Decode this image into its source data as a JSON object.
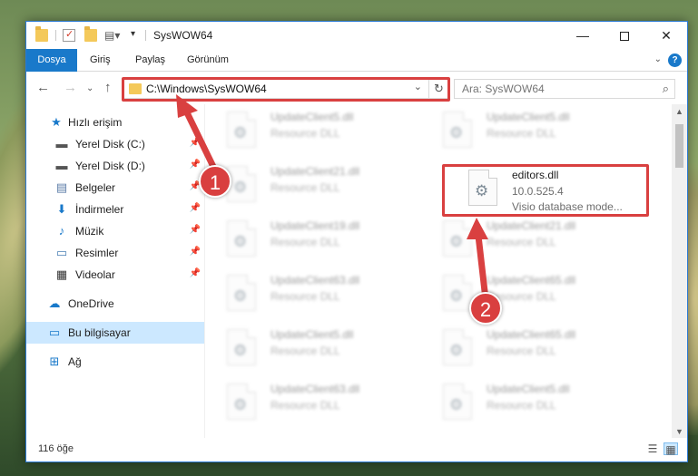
{
  "window": {
    "title": "SysWOW64",
    "controls": {
      "minimize": "—",
      "maximize": "",
      "close": "✕"
    }
  },
  "ribbon": {
    "tabs": [
      "Dosya",
      "Giriş",
      "Paylaş",
      "Görünüm"
    ],
    "help": "?"
  },
  "address": {
    "path": "C:\\Windows\\SysWOW64",
    "search_placeholder": "Ara: SysWOW64"
  },
  "nav_pane": {
    "items": [
      {
        "label": "Hızlı erişim",
        "icon": "star-icon"
      },
      {
        "label": "Yerel Disk (C:)",
        "icon": "drive-icon",
        "pinned": true
      },
      {
        "label": "Yerel Disk (D:)",
        "icon": "drive-icon",
        "pinned": true
      },
      {
        "label": "Belgeler",
        "icon": "document-icon",
        "pinned": true
      },
      {
        "label": "İndirmeler",
        "icon": "download-icon",
        "pinned": true
      },
      {
        "label": "Müzik",
        "icon": "music-icon",
        "pinned": true
      },
      {
        "label": "Resimler",
        "icon": "picture-icon",
        "pinned": true
      },
      {
        "label": "Videolar",
        "icon": "video-icon",
        "pinned": true
      },
      {
        "label": "OneDrive",
        "icon": "cloud-icon"
      },
      {
        "label": "Bu bilgisayar",
        "icon": "computer-icon",
        "selected": true
      },
      {
        "label": "Ağ",
        "icon": "network-icon"
      }
    ]
  },
  "files": {
    "left": [
      {
        "name": "UpdateClient5.dll",
        "type": "Resource DLL"
      },
      {
        "name": "UpdateClient21.dll",
        "type": "Resource DLL"
      },
      {
        "name": "UpdateClient19.dll",
        "type": "Resource DLL"
      },
      {
        "name": "UpdateClient63.dll",
        "type": "Resource DLL"
      },
      {
        "name": "UpdateClient5.dll",
        "type": "Resource DLL"
      },
      {
        "name": "UpdateClient63.dll",
        "type": "Resource DLL"
      }
    ],
    "right": [
      {
        "name": "UpdateClient5.dll",
        "type": "Resource DLL"
      },
      {
        "name": "UpdateClient21.dll",
        "type": "Resource DLL"
      },
      {
        "name": "UpdateClient65.dll",
        "type": "Resource DLL"
      },
      {
        "name": "UpdateClient65.dll",
        "type": "Resource DLL"
      },
      {
        "name": "UpdateClient5.dll",
        "type": "Resource DLL"
      }
    ],
    "highlighted": {
      "name": "editors.dll",
      "version": "10.0.525.4",
      "description": "Visio database mode..."
    }
  },
  "status": {
    "item_count": "116 öğe"
  },
  "annotations": {
    "step1": "1",
    "step2": "2",
    "color": "#d94040"
  }
}
